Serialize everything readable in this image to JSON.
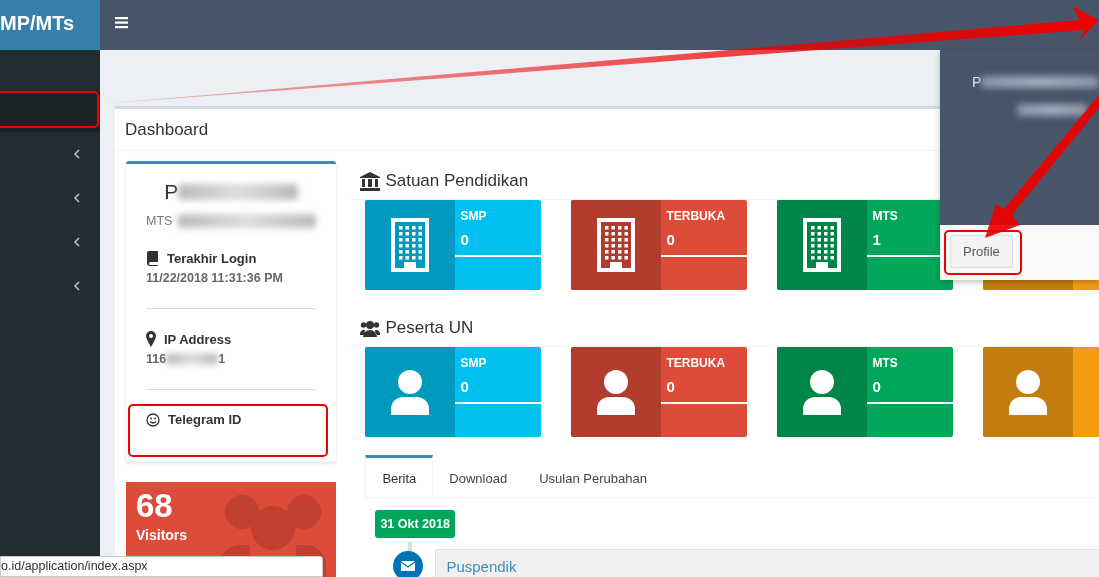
{
  "brand": "MP/MTs",
  "sidebar": {
    "items": [
      {
        "kind": "plain"
      },
      {
        "kind": "submenu"
      },
      {
        "kind": "submenu"
      },
      {
        "kind": "submenu"
      },
      {
        "kind": "submenu"
      }
    ]
  },
  "page_title": "Dashboard",
  "profile": {
    "name": "P",
    "school": "MTS",
    "fields": [
      {
        "kind": "login",
        "label": "Terakhir Login",
        "value": "11/22/2018 11:31:36 PM"
      },
      {
        "kind": "ip",
        "label": "IP Address",
        "value_start": "116",
        "value_end": "1"
      },
      {
        "kind": "telegram",
        "label": "Telegram ID"
      }
    ]
  },
  "visitors": {
    "count": "68",
    "label": "Visitors"
  },
  "sections": [
    {
      "kind": "school",
      "title": "Satuan Pendidikan",
      "tiles": [
        {
          "label": "SMP",
          "value": "0",
          "color": "#00c0ef"
        },
        {
          "label": "TERBUKA",
          "value": "0",
          "color": "#dd4b39"
        },
        {
          "label": "MTS",
          "value": "1",
          "color": "#00a65a"
        },
        {
          "color": "#f39c12"
        }
      ]
    },
    {
      "kind": "people",
      "title": "Peserta UN",
      "tiles": [
        {
          "label": "SMP",
          "value": "0",
          "color": "#00c0ef"
        },
        {
          "label": "TERBUKA",
          "value": "0",
          "color": "#dd4b39"
        },
        {
          "label": "MTS",
          "value": "0",
          "color": "#00a65a"
        },
        {
          "color": "#f39c12"
        }
      ]
    }
  ],
  "tabs": [
    {
      "label": "Berita",
      "selected": true
    },
    {
      "label": "Download",
      "selected": false
    },
    {
      "label": "Usulan Perubahan",
      "selected": false
    }
  ],
  "timeline": {
    "date": "31 Okt 2018",
    "items": [
      {
        "title": "Puspendik"
      }
    ]
  },
  "user_menu": {
    "name": "P",
    "button": "Profile"
  },
  "status_url": "o.id/application/index.aspx"
}
